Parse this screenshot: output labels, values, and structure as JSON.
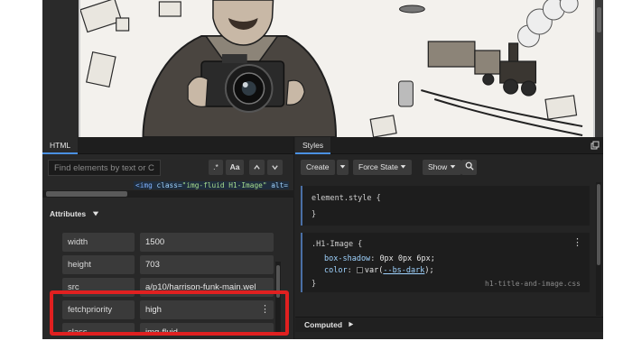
{
  "html_panel": {
    "tab_label": "HTML",
    "search_placeholder": "Find elements by text or CS",
    "regex_label": ".*",
    "case_label": "Aa",
    "code_line": {
      "tag_open": "<img",
      "class_attr": " class=",
      "class_val": "\"img-fluid H1-Image\"",
      "alt_attr": " alt=",
      "alt_val": "\"H"
    },
    "attributes_label": "Attributes",
    "attributes": [
      {
        "name": "width",
        "value": "1500"
      },
      {
        "name": "height",
        "value": "703"
      },
      {
        "name": "src",
        "value": "a/p10/harrison-funk-main.wel"
      },
      {
        "name": "fetchpriority",
        "value": "high"
      },
      {
        "name": "class",
        "value": "img-fluid"
      }
    ]
  },
  "styles_panel": {
    "tab_label": "Styles",
    "buttons": {
      "create": "Create",
      "force_state": "Force State",
      "show": "Show"
    },
    "element_style": {
      "selector": "element.style {",
      "close": "}"
    },
    "rule": {
      "selector": ".H1-Image {",
      "prop1": "box-shadow",
      "val1": "0px 0px 6px;",
      "prop2": "color",
      "val2_prefix": "var(",
      "val2_var": "--bs-dark",
      "val2_suffix": ");",
      "close": "}",
      "source": "h1-title-and-image.css"
    },
    "computed_label": "Computed"
  },
  "icons": {
    "dropdown": "caret-down-icon",
    "search": "search-icon",
    "up": "chevron-up-icon",
    "down": "chevron-down-icon",
    "kebab": "kebab-menu-icon",
    "detach": "detach-window-icon",
    "disclosure": "triangle-right-icon"
  },
  "colors": {
    "highlight": "#e02020",
    "panel_bg": "#242424",
    "accent": "#4a90e2"
  }
}
